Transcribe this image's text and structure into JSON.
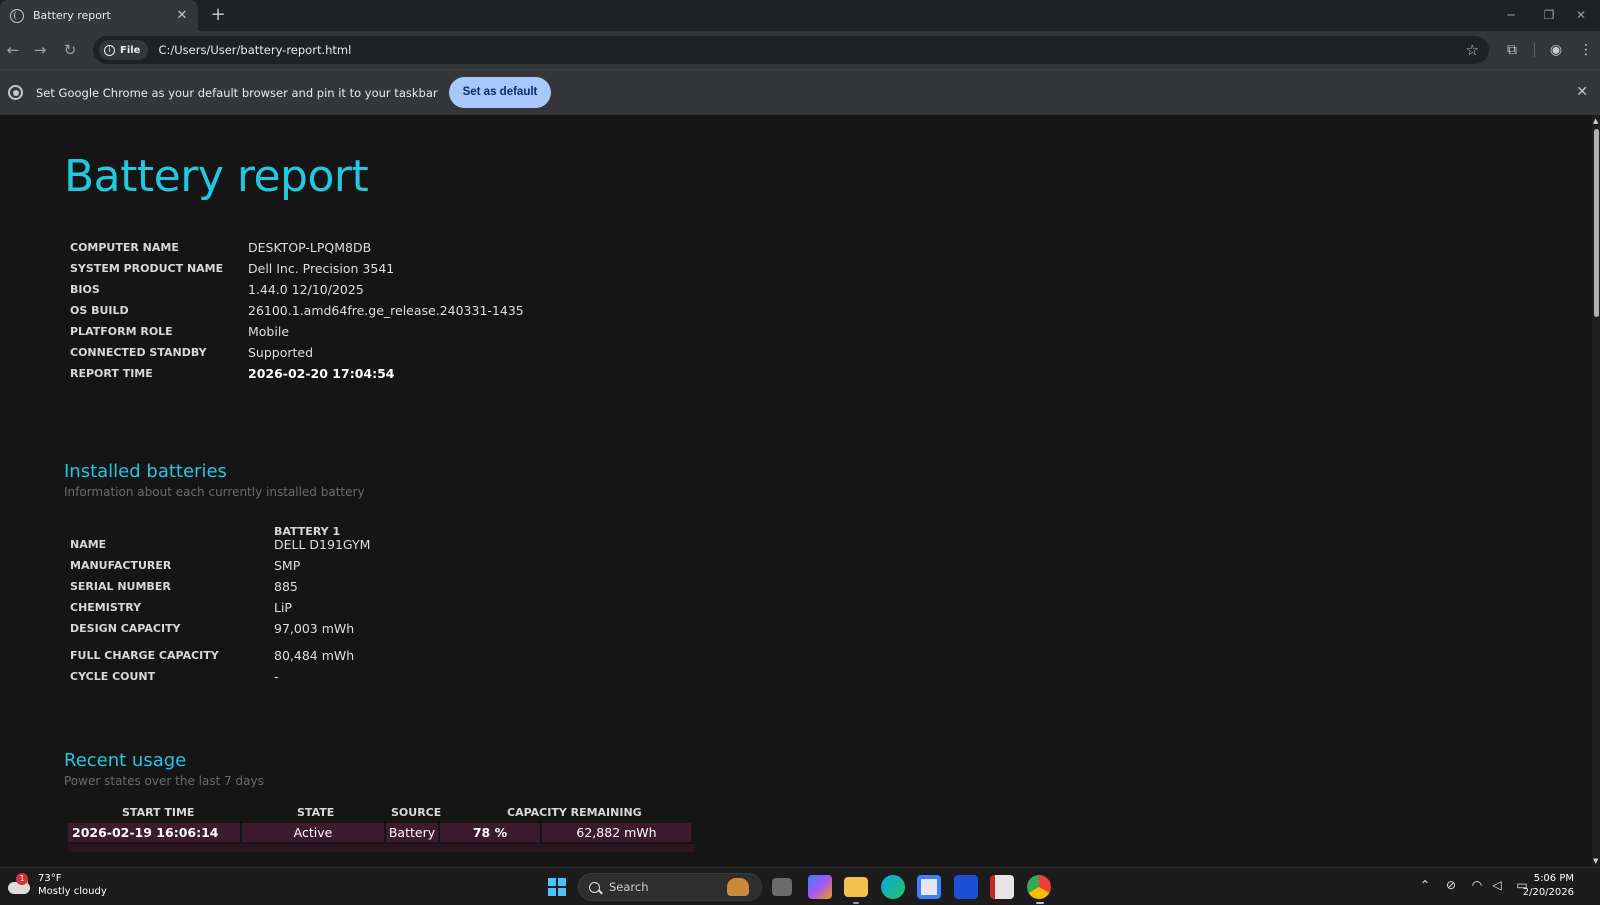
{
  "browser": {
    "tab_title": "Battery report",
    "tab_close": "✕",
    "new_tab": "+",
    "chip_label": "File",
    "url": "C:/Users/User/battery-report.html",
    "infobar_text": "Set Google Chrome as your default browser and pin it to your taskbar",
    "infobar_button": "Set as default",
    "infobar_close": "✕"
  },
  "report": {
    "title": "Battery report",
    "system": [
      {
        "label": "COMPUTER NAME",
        "value": "DESKTOP-LPQM8DB"
      },
      {
        "label": "SYSTEM PRODUCT NAME",
        "value": "Dell Inc. Precision 3541"
      },
      {
        "label": "BIOS",
        "value": "1.44.0 12/10/2025"
      },
      {
        "label": "OS BUILD",
        "value": "26100.1.amd64fre.ge_release.240331-1435"
      },
      {
        "label": "PLATFORM ROLE",
        "value": "Mobile"
      },
      {
        "label": "CONNECTED STANDBY",
        "value": "Supported"
      },
      {
        "label": "REPORT TIME",
        "value": "2026-02-20  17:04:54"
      }
    ],
    "installed": {
      "title": "Installed batteries",
      "subtitle": "Information about each currently installed battery",
      "column": "BATTERY 1",
      "rows": [
        {
          "label": "NAME",
          "value": "DELL D191GYM"
        },
        {
          "label": "MANUFACTURER",
          "value": "SMP"
        },
        {
          "label": "SERIAL NUMBER",
          "value": "885"
        },
        {
          "label": "CHEMISTRY",
          "value": "LiP"
        },
        {
          "label": "DESIGN CAPACITY",
          "value": "97,003 mWh"
        },
        {
          "label": "FULL CHARGE CAPACITY",
          "value": "80,484 mWh"
        },
        {
          "label": "CYCLE COUNT",
          "value": "-"
        }
      ]
    },
    "recent": {
      "title": "Recent usage",
      "subtitle": "Power states over the last 7 days",
      "headers": [
        "START TIME",
        "STATE",
        "SOURCE",
        "CAPACITY REMAINING"
      ],
      "rows": [
        {
          "start": "2026-02-19  16:06:14",
          "state": "Active",
          "source": "Battery",
          "percent": "78 %",
          "mwh": "62,882 mWh"
        }
      ]
    }
  },
  "taskbar": {
    "weather_temp": "73°F",
    "weather_condition": "Mostly cloudy",
    "weather_badge": "1",
    "search_label": "Search",
    "time": "5:06 PM",
    "date": "2/20/2026"
  },
  "icons": {
    "back": "back-arrow-icon",
    "forward": "forward-arrow-icon",
    "reload": "reload-icon",
    "star": "bookmark-star-icon",
    "accent": "#22c7e0",
    "button_color": "#a8c7fa"
  }
}
